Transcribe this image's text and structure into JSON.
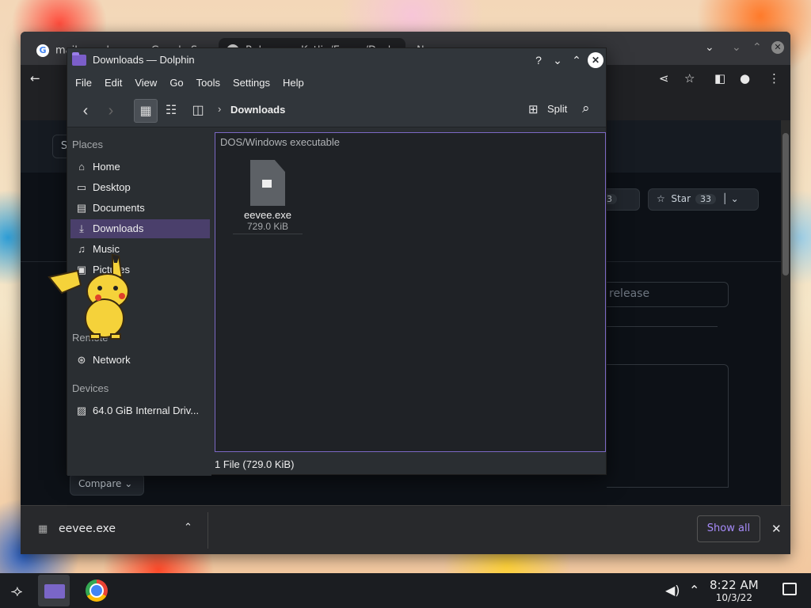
{
  "chrome": {
    "tabs": [
      {
        "label": "mail.google.com - Google Search N..."
      },
      {
        "label": "Releases · Kotlin/Eevee/Deskop - N..."
      }
    ]
  },
  "github": {
    "s_button": "S",
    "fork_count": "3",
    "star_label": "Star",
    "star_count": "33",
    "search_placeholder": "release",
    "compare_label": "Compare"
  },
  "download_bar": {
    "file_name": "eevee.exe",
    "show_all_label": "Show all"
  },
  "dolphin": {
    "title": "Downloads — Dolphin",
    "menu": [
      "File",
      "Edit",
      "View",
      "Go",
      "Tools",
      "Settings",
      "Help"
    ],
    "breadcrumb": "Downloads",
    "split_label": "Split",
    "sidebar": {
      "places_heading": "Places",
      "places": [
        "Home",
        "Desktop",
        "Documents",
        "Downloads",
        "Music",
        "Pictures"
      ],
      "remote_heading": "Remote",
      "remote": [
        "Network"
      ],
      "devices_heading": "Devices",
      "devices": [
        "64.0 GiB Internal Driv..."
      ]
    },
    "group_label": "DOS/Windows executable",
    "file": {
      "name": "eevee.exe",
      "size": "729.0 KiB"
    },
    "status": "1 File (729.0 KiB)"
  },
  "taskbar": {
    "time": "8:22 AM",
    "date": "10/3/22"
  }
}
